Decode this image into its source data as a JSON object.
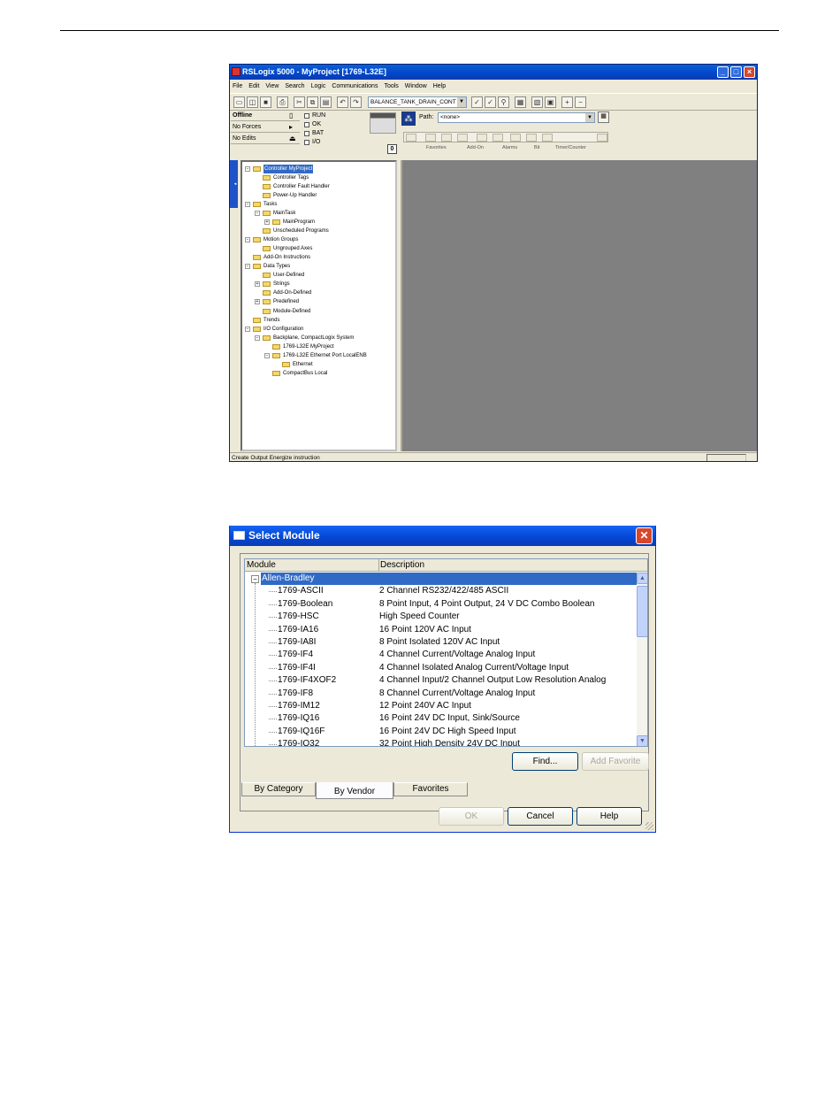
{
  "rslogix": {
    "title": "RSLogix 5000 - MyProject [1769-L32E]",
    "menu": [
      "File",
      "Edit",
      "View",
      "Search",
      "Logic",
      "Communications",
      "Tools",
      "Window",
      "Help"
    ],
    "routine_combo": "BALANCE_TANK_DRAIN_CONT",
    "status": {
      "mode": "Offline",
      "forces": "No Forces",
      "edits": "No Edits",
      "leds": [
        "RUN",
        "OK",
        "BAT",
        "I/O"
      ]
    },
    "path_label": "Path:",
    "path_value": "<none>",
    "instruction_tabs": [
      "Favorites",
      "Add-On",
      "Alarms",
      "Bit",
      "Timer/Counter"
    ],
    "tree": [
      {
        "label": "Controller MyProject",
        "indent": 0,
        "expander": "-",
        "selected": true
      },
      {
        "label": "Controller Tags",
        "indent": 1
      },
      {
        "label": "Controller Fault Handler",
        "indent": 1
      },
      {
        "label": "Power-Up Handler",
        "indent": 1
      },
      {
        "label": "Tasks",
        "indent": 0,
        "expander": "-"
      },
      {
        "label": "MainTask",
        "indent": 1,
        "expander": "-"
      },
      {
        "label": "MainProgram",
        "indent": 2,
        "expander": "+"
      },
      {
        "label": "Unscheduled Programs",
        "indent": 1
      },
      {
        "label": "Motion Groups",
        "indent": 0,
        "expander": "-"
      },
      {
        "label": "Ungrouped Axes",
        "indent": 1
      },
      {
        "label": "Add-On Instructions",
        "indent": 0
      },
      {
        "label": "Data Types",
        "indent": 0,
        "expander": "-"
      },
      {
        "label": "User-Defined",
        "indent": 1
      },
      {
        "label": "Strings",
        "indent": 1,
        "expander": "+"
      },
      {
        "label": "Add-On-Defined",
        "indent": 1
      },
      {
        "label": "Predefined",
        "indent": 1,
        "expander": "+"
      },
      {
        "label": "Module-Defined",
        "indent": 1
      },
      {
        "label": "Trends",
        "indent": 0
      },
      {
        "label": "I/O Configuration",
        "indent": 0,
        "expander": "-"
      },
      {
        "label": "Backplane, CompactLogix System",
        "indent": 1,
        "expander": "-"
      },
      {
        "label": "1769-L32E MyProject",
        "indent": 2
      },
      {
        "label": "1769-L32E Ethernet Port LocalENB",
        "indent": 2,
        "expander": "-"
      },
      {
        "label": "Ethernet",
        "indent": 3
      },
      {
        "label": "CompactBus Local",
        "indent": 2
      }
    ],
    "status_bar": "Create Output Energize instruction"
  },
  "dialog": {
    "title": "Select Module",
    "col_module": "Module",
    "col_description": "Description",
    "vendor": "Allen-Bradley",
    "modules": [
      {
        "module": "1769-ASCII",
        "description": "2 Channel RS232/422/485 ASCII"
      },
      {
        "module": "1769-Boolean",
        "description": "8 Point Input, 4 Point Output, 24 V DC Combo Boolean"
      },
      {
        "module": "1769-HSC",
        "description": "High Speed Counter"
      },
      {
        "module": "1769-IA16",
        "description": "16 Point 120V AC Input"
      },
      {
        "module": "1769-IA8I",
        "description": "8 Point Isolated 120V AC Input"
      },
      {
        "module": "1769-IF4",
        "description": "4 Channel Current/Voltage Analog Input"
      },
      {
        "module": "1769-IF4I",
        "description": "4 Channel Isolated Analog Current/Voltage Input"
      },
      {
        "module": "1769-IF4XOF2",
        "description": "4 Channel Input/2 Channel Output Low Resolution Analog"
      },
      {
        "module": "1769-IF8",
        "description": "8 Channel Current/Voltage Analog Input"
      },
      {
        "module": "1769-IM12",
        "description": "12 Point 240V AC Input"
      },
      {
        "module": "1769-IQ16",
        "description": "16 Point 24V DC Input, Sink/Source"
      },
      {
        "module": "1769-IQ16F",
        "description": "16 Point 24V DC High Speed Input"
      },
      {
        "module": "1769-IQ32",
        "description": "32 Point High Density 24V DC Input"
      }
    ],
    "find_label": "Find...",
    "add_favorite_label": "Add Favorite",
    "tabs": [
      "By Category",
      "By Vendor",
      "Favorites"
    ],
    "active_tab": "By Vendor",
    "ok_label": "OK",
    "cancel_label": "Cancel",
    "help_label": "Help"
  },
  "colors": {
    "titlebar": "#0348d6",
    "selection": "#316ac5",
    "workspace": "#808080",
    "dialog_bg": "#ece9d8"
  }
}
